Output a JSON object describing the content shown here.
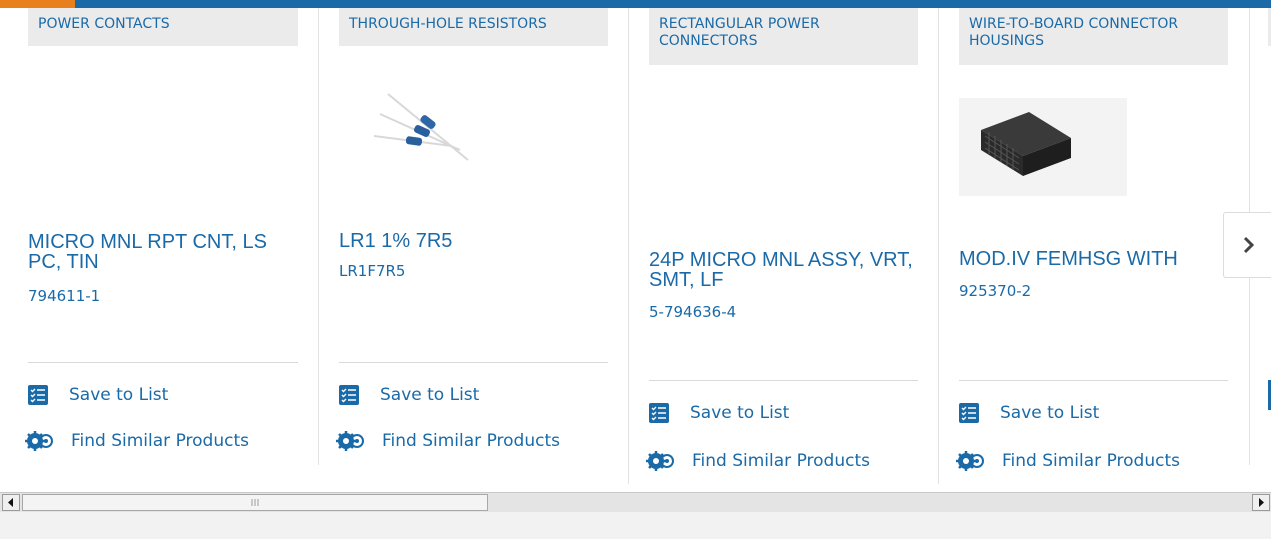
{
  "colors": {
    "brand_blue": "#1a6aa8",
    "accent_orange": "#e8801e",
    "category_bg": "#ebebeb"
  },
  "cards": [
    {
      "category": "POWER CONTACTS",
      "title": "MICRO MNL RPT CNT, LS PC, TIN",
      "part_number": "794611-1",
      "save_label": "Save to List",
      "similar_label": "Find Similar Products"
    },
    {
      "category": "THROUGH-HOLE RESISTORS",
      "title": "LR1 1% 7R5",
      "part_number": "LR1F7R5",
      "save_label": "Save to List",
      "similar_label": "Find Similar Products"
    },
    {
      "category": "RECTANGULAR POWER CONNECTORS",
      "title": "24P MICRO MNL ASSY, VRT, SMT, LF",
      "part_number": "5-794636-4",
      "save_label": "Save to List",
      "similar_label": "Find Similar Products"
    },
    {
      "category": "WIRE-TO-BOARD CONNECTOR HOUSINGS",
      "title": "MOD.IV FEMHSG WITH",
      "part_number": "925370-2",
      "save_label": "Save to List",
      "similar_label": "Find Similar Products"
    }
  ],
  "carousel": {
    "next_icon": "chevron-right-icon"
  }
}
